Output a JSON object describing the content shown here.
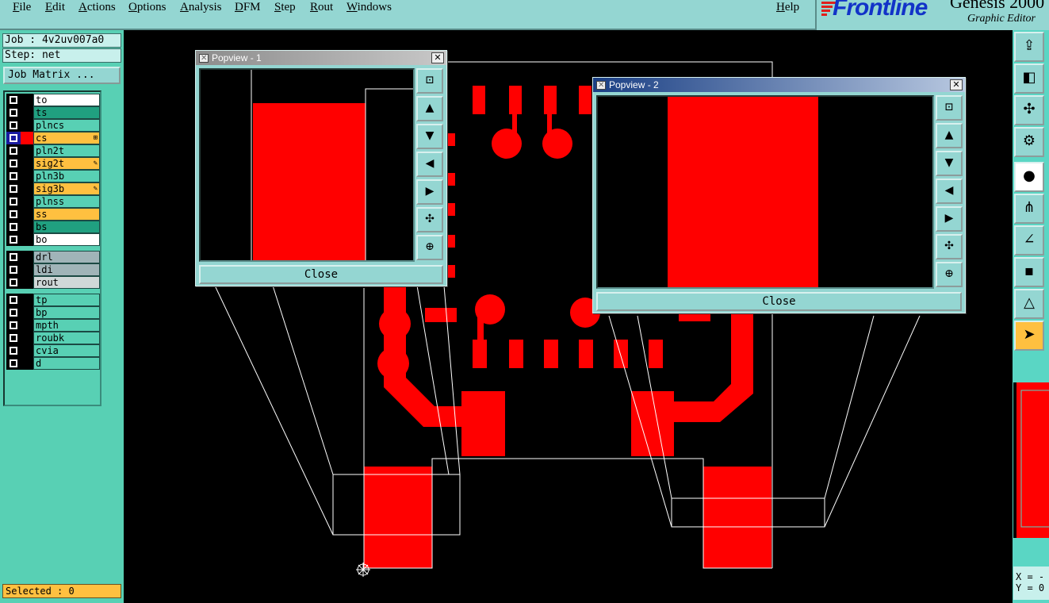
{
  "menu": {
    "items": [
      "File",
      "Edit",
      "Actions",
      "Options",
      "Analysis",
      "DFM",
      "Step",
      "Rout",
      "Windows"
    ],
    "help": "Help"
  },
  "brand": {
    "logo": "Frontline",
    "product": "Genesis 2000",
    "subtitle": "Graphic Editor"
  },
  "job": {
    "job_label": "Job : 4v2uv007a0",
    "step_label": "Step: net",
    "matrix_button": "Job Matrix ..."
  },
  "layers": [
    {
      "name": "to",
      "color": "#ffffff",
      "checked": false
    },
    {
      "name": "ts",
      "color": "#20a080",
      "checked": false
    },
    {
      "name": "plncs",
      "color": "#58d0b4",
      "checked": false
    },
    {
      "name": "cs",
      "color": "#ffc040",
      "checked": true,
      "swatch": "red",
      "mark": "⊞"
    },
    {
      "name": "pln2t",
      "color": "#58d0b4",
      "checked": false
    },
    {
      "name": "sig2t",
      "color": "#ffc040",
      "checked": false,
      "mark": "✎"
    },
    {
      "name": "pln3b",
      "color": "#58d0b4",
      "checked": false
    },
    {
      "name": "sig3b",
      "color": "#ffc040",
      "checked": false,
      "mark": "✎"
    },
    {
      "name": "plnss",
      "color": "#58d0b4",
      "checked": false
    },
    {
      "name": "ss",
      "color": "#ffc040",
      "checked": false
    },
    {
      "name": "bs",
      "color": "#20a080",
      "checked": false
    },
    {
      "name": "bo",
      "color": "#ffffff",
      "checked": false
    },
    {
      "name": "drl",
      "color": "#a0b4b8",
      "checked": false
    },
    {
      "name": "ldi",
      "color": "#a0b4b8",
      "checked": false
    },
    {
      "name": "rout",
      "color": "#d0d8d8",
      "checked": false
    },
    {
      "name": "tp",
      "color": "#58d0b4",
      "checked": false
    },
    {
      "name": "bp",
      "color": "#58d0b4",
      "checked": false
    },
    {
      "name": "mpth",
      "color": "#58d0b4",
      "checked": false
    },
    {
      "name": "roubk",
      "color": "#58d0b4",
      "checked": false
    },
    {
      "name": "cvia",
      "color": "#58d0b4",
      "checked": false
    },
    {
      "name": "d",
      "color": "#58d0b4",
      "checked": false
    }
  ],
  "selected": "Selected : 0",
  "popview1": {
    "title": "Popview - 1",
    "close": "Close"
  },
  "popview2": {
    "title": "Popview - 2",
    "close": "Close"
  },
  "coords": {
    "x": "X = -",
    "y": "Y = 0"
  },
  "colors": {
    "panel": "#58d0b4",
    "menubar": "#94d6d2",
    "feature": "#ff0000",
    "active_title": "#1e4a8c",
    "inactive_title": "#a8a8a8",
    "highlight": "#ffc040"
  }
}
